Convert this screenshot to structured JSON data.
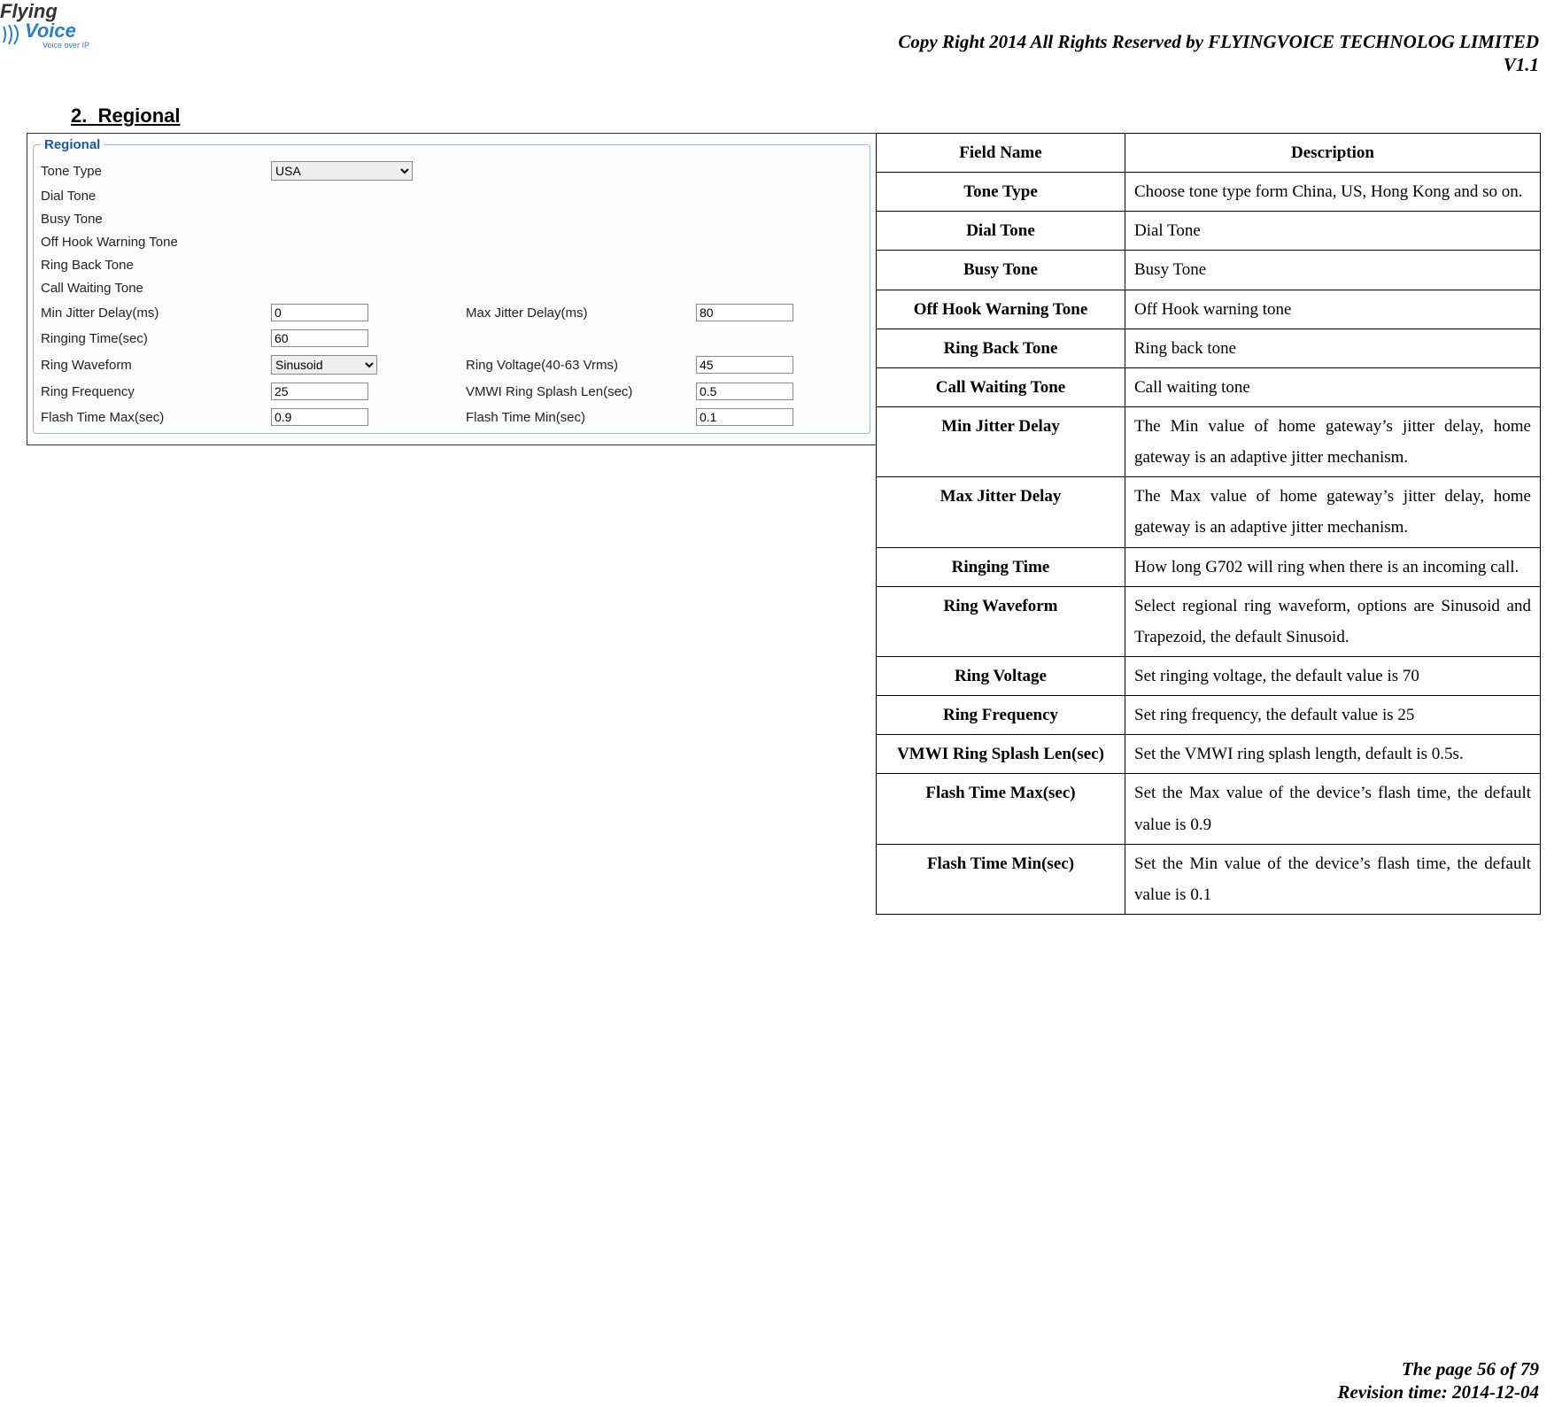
{
  "header": {
    "copyright": "Copy Right 2014 All Rights Reserved by FLYINGVOICE TECHNOLOG LIMITED",
    "version": "V1.1"
  },
  "logo": {
    "line1": "Flying",
    "line2": "Voice",
    "sub": "Voice over IP"
  },
  "section": {
    "number": "2.",
    "title": "Regional"
  },
  "shot": {
    "legend": "Regional",
    "labels": {
      "tone_type": "Tone Type",
      "dial_tone": "Dial Tone",
      "busy_tone": "Busy Tone",
      "off_hook": "Off Hook Warning Tone",
      "ring_back": "Ring Back Tone",
      "call_waiting": "Call Waiting Tone",
      "min_jitter": "Min Jitter Delay(ms)",
      "max_jitter": "Max Jitter Delay(ms)",
      "ringing_time": "Ringing Time(sec)",
      "ring_waveform": "Ring Waveform",
      "ring_voltage": "Ring Voltage(40-63 Vrms)",
      "ring_frequency": "Ring Frequency",
      "vmwi": "VMWI Ring Splash Len(sec)",
      "flash_max": "Flash Time Max(sec)",
      "flash_min": "Flash Time Min(sec)"
    },
    "values": {
      "tone_type": "USA",
      "min_jitter": "0",
      "max_jitter": "80",
      "ringing_time": "60",
      "ring_waveform": "Sinusoid",
      "ring_voltage": "45",
      "ring_frequency": "25",
      "vmwi": "0.5",
      "flash_max": "0.9",
      "flash_min": "0.1"
    }
  },
  "table": {
    "head_field": "Field Name",
    "head_desc": "Description",
    "rows": [
      {
        "name": "Tone Type",
        "desc": "Choose tone type form China, US, Hong Kong and so on."
      },
      {
        "name": "Dial Tone",
        "desc": "Dial Tone"
      },
      {
        "name": "Busy Tone",
        "desc": "Busy Tone"
      },
      {
        "name": "Off Hook Warning Tone",
        "desc": "Off Hook warning tone"
      },
      {
        "name": "Ring Back Tone",
        "desc": "Ring back tone"
      },
      {
        "name": "Call Waiting Tone",
        "desc": "Call waiting tone"
      },
      {
        "name": "Min Jitter Delay",
        "desc": "The Min value of home gateway’s jitter delay, home gateway is an adaptive jitter mechanism."
      },
      {
        "name": "Max Jitter Delay",
        "desc": "The Max value of home gateway’s jitter delay, home gateway is an adaptive jitter mechanism."
      },
      {
        "name": "Ringing Time",
        "desc": "How long G702 will ring when there is an incoming call."
      },
      {
        "name": "Ring Waveform",
        "desc": "Select regional ring waveform, options are Sinusoid and Trapezoid, the default Sinusoid."
      },
      {
        "name": "Ring Voltage",
        "desc": "Set ringing voltage, the default value is 70"
      },
      {
        "name": "Ring Frequency",
        "desc": "Set ring frequency, the default value is 25"
      },
      {
        "name": "VMWI Ring Splash Len(sec)",
        "desc": "Set the VMWI ring splash length, default is 0.5s."
      },
      {
        "name": "Flash Time Max(sec)",
        "desc": "Set the Max value of the device’s flash time, the default value is 0.9"
      },
      {
        "name": "Flash Time Min(sec)",
        "desc": "Set the Min value of the device’s flash time, the default value is 0.1"
      }
    ]
  },
  "footer": {
    "page": "The page 56 of 79",
    "revision": "Revision time: 2014-12-04"
  }
}
